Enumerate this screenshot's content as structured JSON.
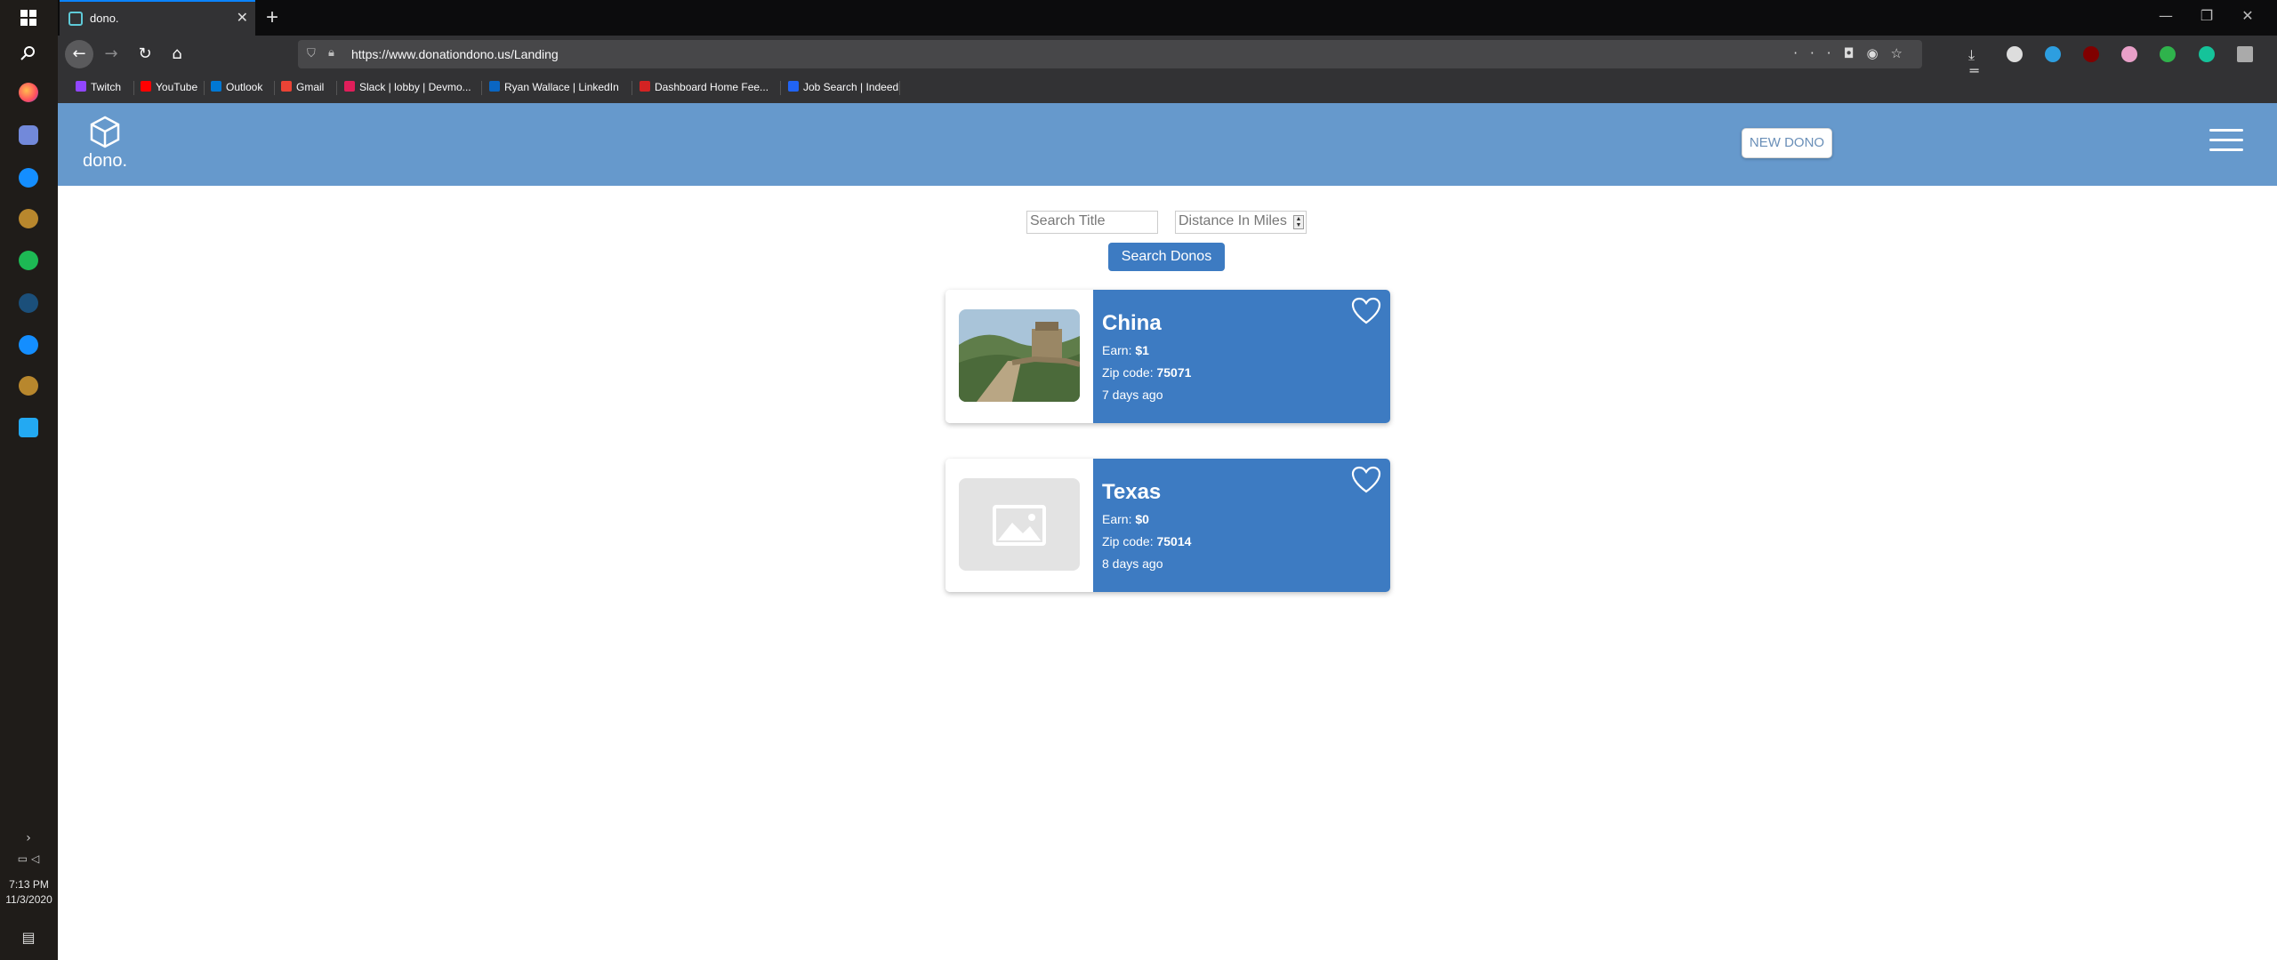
{
  "browser": {
    "tab_title": "dono.",
    "url": "https://www.donationdono.us/Landing",
    "bookmarks": [
      {
        "label": "Twitch",
        "color": "#9146ff"
      },
      {
        "label": "YouTube",
        "color": "#ff0000"
      },
      {
        "label": "Outlook",
        "color": "#0078d4"
      },
      {
        "label": "Gmail",
        "color": "#ea4335"
      },
      {
        "label": "Slack | lobby | Devmo...",
        "color": "#e01e5a"
      },
      {
        "label": "Ryan Wallace | LinkedIn",
        "color": "#0a66c2"
      },
      {
        "label": "Dashboard Home Fee...",
        "color": "#d32323"
      },
      {
        "label": "Job Search | Indeed",
        "color": "#2164f3"
      }
    ]
  },
  "taskbar": {
    "time": "7:13 PM",
    "date": "11/3/2020"
  },
  "site": {
    "logo_text": "dono.",
    "new_dono_label": "NEW DONO",
    "search_title_placeholder": "Search Title",
    "distance_placeholder": "Distance In Miles",
    "search_button_label": "Search Donos"
  },
  "donos": [
    {
      "title": "China",
      "earn_label": "Earn:",
      "earn_value": "$1",
      "zip_label": "Zip code:",
      "zip_value": "75071",
      "age": "7 days ago",
      "image": "great-wall-photo"
    },
    {
      "title": "Texas",
      "earn_label": "Earn:",
      "earn_value": "$0",
      "zip_label": "Zip code:",
      "zip_value": "75014",
      "age": "8 days ago",
      "image": "placeholder-image"
    }
  ],
  "colors": {
    "header_bg": "#6699cc",
    "card_bg": "#3d7bc2",
    "button_bg": "#3d7bc2"
  }
}
